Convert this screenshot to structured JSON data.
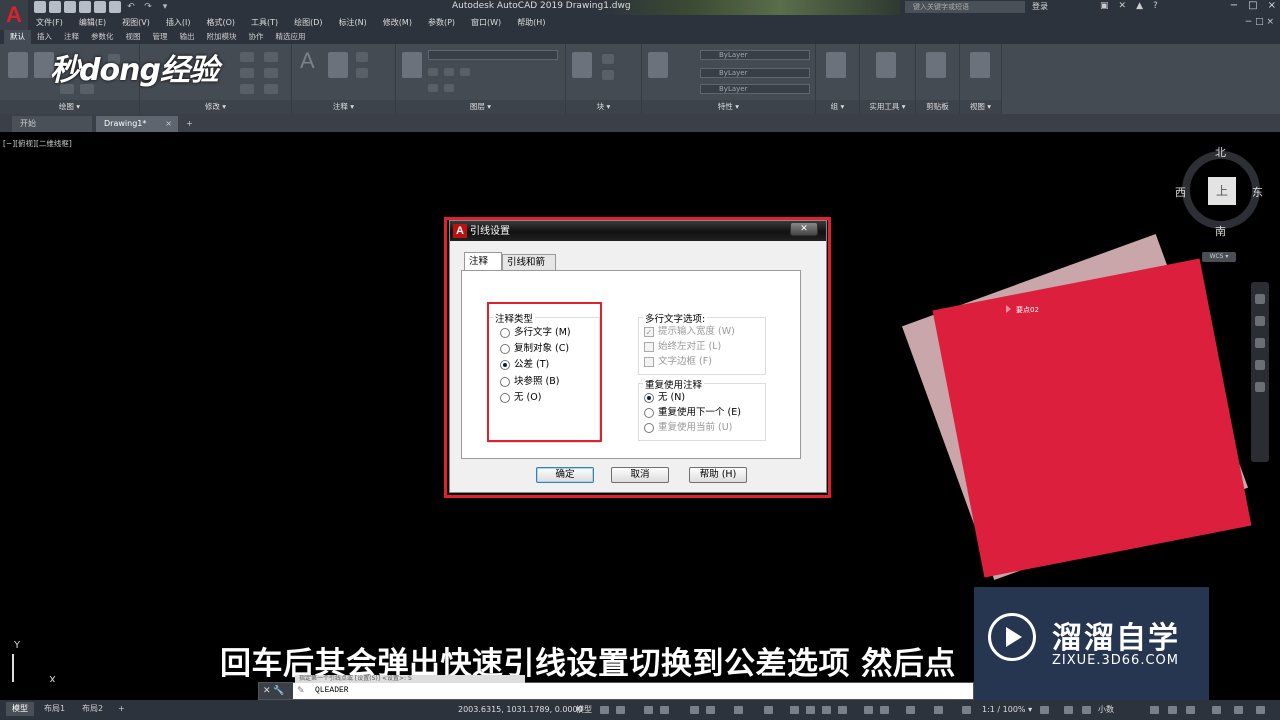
{
  "app": {
    "logo": "A",
    "title": "Autodesk AutoCAD 2019    Drawing1.dwg",
    "search_placeholder": "键入关键字或短语",
    "login": "登录",
    "window_controls": [
      "−",
      "□",
      "×"
    ]
  },
  "watermark_logo": "秒dong经验",
  "menus": [
    "文件(F)",
    "编辑(E)",
    "视图(V)",
    "插入(I)",
    "格式(O)",
    "工具(T)",
    "绘图(D)",
    "标注(N)",
    "修改(M)",
    "参数(P)",
    "窗口(W)",
    "帮助(H)"
  ],
  "ribbon_tabs": [
    "默认",
    "插入",
    "注释",
    "参数化",
    "视图",
    "管理",
    "输出",
    "附加模块",
    "协作",
    "精选应用"
  ],
  "ribbon_panels": [
    "绘图 ▾",
    "修改 ▾",
    "注释 ▾",
    "图层 ▾",
    "块 ▾",
    "特性 ▾",
    "组 ▾",
    "实用工具 ▾",
    "剪贴板",
    "视图 ▾"
  ],
  "ribbon_combos": {
    "bylayer_1": "ByLayer",
    "bylayer_2": "ByLayer",
    "bylayer_3": "ByLayer"
  },
  "doc_tabs": {
    "start": "开始",
    "drawing": "Drawing1*",
    "close": "×",
    "add": "+"
  },
  "viewport_label": "[−][俯视][二维线框]",
  "viewcube": {
    "north": "北",
    "south": "南",
    "east": "东",
    "west": "西",
    "face": "上",
    "wcs": "WCS ▾"
  },
  "card_label": "要点02",
  "ucs": {
    "y": "Y",
    "x": "X"
  },
  "subtitle": "回车后其会弹出快速引线设置切换到公差选项 然后点",
  "brand": {
    "name": "溜溜自学",
    "url": "ZIXUE.3D66.COM"
  },
  "dialog": {
    "title": "引线设置",
    "close": "✕",
    "tabs": [
      "注释",
      "引线和箭头"
    ],
    "annotation_type": {
      "title": "注释类型",
      "options": [
        {
          "label": "多行文字 (M)",
          "selected": false
        },
        {
          "label": "复制对象 (C)",
          "selected": false
        },
        {
          "label": "公差 (T)",
          "selected": true
        },
        {
          "label": "块参照 (B)",
          "selected": false
        },
        {
          "label": "无 (O)",
          "selected": false
        }
      ]
    },
    "mtext_options": {
      "title": "多行文字选项:",
      "options": [
        {
          "label": "提示输入宽度 (W)",
          "checked": true
        },
        {
          "label": "始终左对正 (L)",
          "checked": false
        },
        {
          "label": "文字边框 (F)",
          "checked": false
        }
      ]
    },
    "reuse": {
      "title": "重复使用注释",
      "options": [
        {
          "label": "无 (N)",
          "selected": true
        },
        {
          "label": "重复使用下一个 (E)",
          "selected": false
        },
        {
          "label": "重复使用当前 (U)",
          "selected": false
        }
      ]
    },
    "buttons": {
      "ok": "确定",
      "cancel": "取消",
      "help": "帮助 (H)"
    }
  },
  "command_line": {
    "buttons": "✕ 🔧",
    "previous": "指定第一个引线点或 [设置(S)] <设置>: S",
    "text": "QLEADER"
  },
  "status": {
    "tabs": [
      "模型",
      "布局1",
      "布局2",
      "+"
    ],
    "coords": "2003.6315, 1031.1789, 0.0000",
    "mode": "模型",
    "scale": "1:1 / 100% ▾",
    "units": "小数"
  }
}
